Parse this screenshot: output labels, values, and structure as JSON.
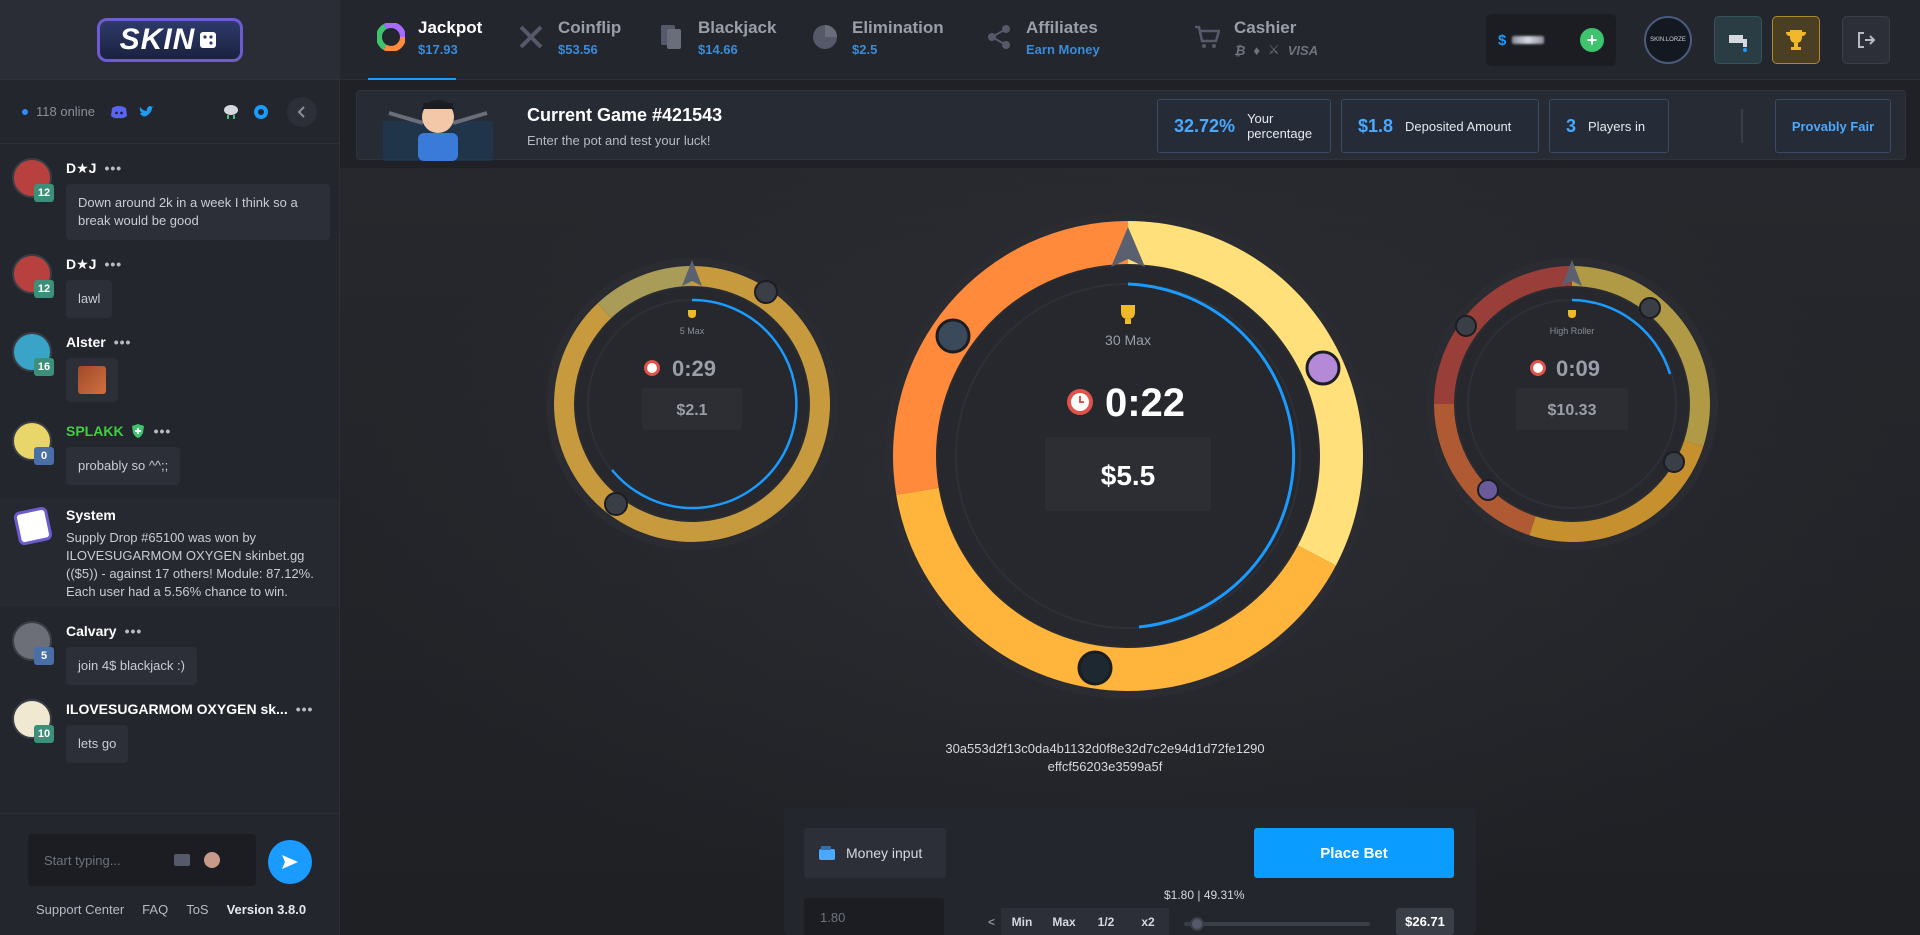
{
  "brand": {
    "logo_text": "SKIN"
  },
  "chat": {
    "online_text": "118 online",
    "input_placeholder": "Start typing...",
    "messages": [
      {
        "name": "D★J",
        "level": "12",
        "text": "Down around 2k in a week I think so a break would be good",
        "level_color": "#3e8f7a",
        "avatar_color": "#b8403f"
      },
      {
        "name": "D★J",
        "level": "12",
        "text": "lawl",
        "level_color": "#3e8f7a",
        "avatar_color": "#b8403f"
      },
      {
        "name": "Alster",
        "level": "16",
        "text": "",
        "level_color": "#3e8f7a",
        "avatar_color": "#3aa4c8"
      },
      {
        "name": "SPLAKK",
        "level": "0",
        "text": "probably so ^^;;",
        "level_color": "#4a6fa8",
        "avatar_color": "#e8d66a",
        "name_color": "#3ed13e"
      },
      {
        "name": "System",
        "text": "Supply Drop #65100 was won by ILOVESUGARMOM OXYGEN skinbet.gg (($5)) - against 17 others! Module: 87.12%. Each user had a 5.56% chance to win."
      },
      {
        "name": "Calvary",
        "level": "5",
        "text": "join 4$ blackjack :)",
        "level_color": "#4a6fa8",
        "avatar_color": "#6c6f78"
      },
      {
        "name": "ILOVESUGARMOM OXYGEN sk...",
        "level": "10",
        "text": "lets go",
        "level_color": "#3e8f7a",
        "avatar_color": "#f0e8d0"
      }
    ],
    "footer": {
      "support": "Support Center",
      "faq": "FAQ",
      "tos": "ToS",
      "version": "Version 3.8.0"
    }
  },
  "nav": {
    "items": [
      {
        "title": "Jackpot",
        "sub": "$17.93"
      },
      {
        "title": "Coinflip",
        "sub": "$53.56"
      },
      {
        "title": "Blackjack",
        "sub": "$14.66"
      },
      {
        "title": "Elimination",
        "sub": "$2.5"
      },
      {
        "title": "Affiliates",
        "sub": "Earn Money"
      },
      {
        "title": "Cashier",
        "sub": "VISA"
      }
    ],
    "balance_symbol": "$",
    "avatar_text": "SKIN.LORZE"
  },
  "game": {
    "title": "Current Game #421543",
    "subtitle": "Enter the pot and test your luck!",
    "percentage": "32.72%",
    "percentage_label": "Your percentage",
    "deposited": "$1.8",
    "deposited_label": "Deposited Amount",
    "players": "3",
    "players_label": "Players in",
    "provably_fair": "Provably Fair",
    "hash_line1": "30a553d2f13c0da4b1132d0f8e32d7c2e94d1d72fe1290",
    "hash_line2": "effcf56203e3599a5f"
  },
  "wheels": {
    "left": {
      "label": "5 Max",
      "timer": "0:29",
      "value": "$2.1",
      "slices": [
        {
          "share": 0.88,
          "color": "#c79a3e"
        },
        {
          "share": 0.12,
          "color": "#a89c58"
        }
      ]
    },
    "center": {
      "label": "30 Max",
      "timer": "0:22",
      "value": "$5.5",
      "slices": [
        {
          "share": 0.3272,
          "color": "#ffe07a"
        },
        {
          "share": 0.3964,
          "color": "#ffb43c"
        },
        {
          "share": 0.2764,
          "color": "#ff8a3c"
        }
      ]
    },
    "right": {
      "label": "High Roller",
      "timer": "0:09",
      "value": "$10.33",
      "slices": [
        {
          "share": 0.3,
          "color": "#b09a45"
        },
        {
          "share": 0.25,
          "color": "#c7902e"
        },
        {
          "share": 0.2,
          "color": "#b05a33"
        },
        {
          "share": 0.25,
          "color": "#9a3e3a"
        }
      ]
    }
  },
  "bet": {
    "money_input": "Money input",
    "place_bet": "Place Bet",
    "amount_placeholder": "1.80",
    "arrow": "<",
    "min": "Min",
    "max": "Max",
    "half": "1/2",
    "double": "x2",
    "slider_label": "$1.80 | 49.31%",
    "slider_fraction": 0.07,
    "max_value": "$26.71"
  },
  "colors": {
    "accent": "#1a9bff",
    "panel": "#23262d",
    "stat": "#4aa8ff"
  }
}
